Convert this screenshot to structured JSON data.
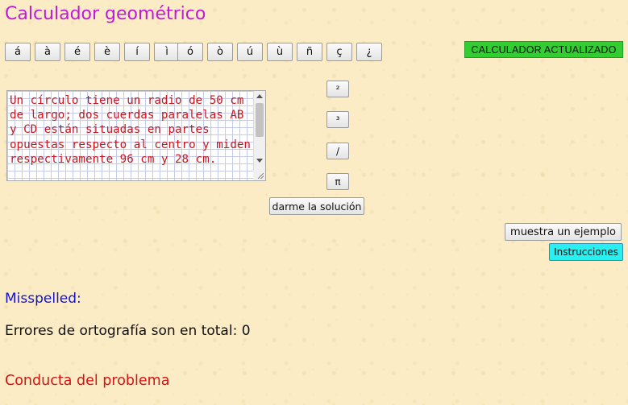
{
  "page": {
    "title": "Calculador geométrico"
  },
  "accent_keys": [
    "á",
    "à",
    "é",
    "è",
    "í",
    "ì",
    "ó",
    "ò",
    "ú",
    "ù",
    "ñ",
    "ç",
    "¿"
  ],
  "status_badge": {
    "label": "CALCULADOR  ACTUALIZADO",
    "color": "#33cc33"
  },
  "problem_input": {
    "value": "Un círculo tiene un radio de 50 cm de largo; dos cuerdas paralelas AB y CD están situadas en partes opuestas respecto al centro y miden respectivamente 96 cm y 28 cm.",
    "text_color": "#c8161c"
  },
  "symbol_keys": {
    "squared": "²",
    "cubed": "³",
    "slash": "/",
    "pi": "π"
  },
  "buttons": {
    "solution": "darme la solución",
    "example": "muestra un ejemplo",
    "instructions": "Instrucciones"
  },
  "spellcheck": {
    "label": "Misspelled:",
    "errors_text": "Errores de ortografía son en total: 0"
  },
  "conduct": {
    "heading": "Conducta del problema"
  },
  "colors": {
    "title": "#c218d8",
    "misspelled": "#1414c8",
    "conduct": "#d11414",
    "instructions_bg": "#28f0f0",
    "background": "#fbecc6"
  }
}
